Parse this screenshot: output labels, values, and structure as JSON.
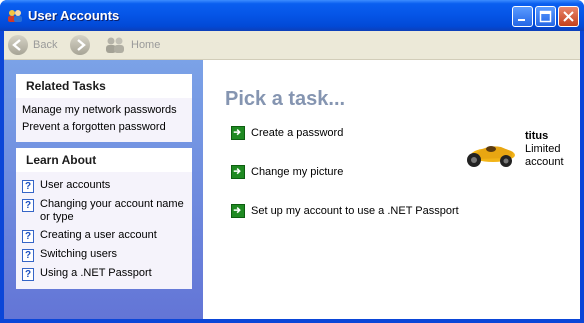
{
  "window": {
    "title": "User Accounts"
  },
  "toolbar": {
    "back_label": "Back",
    "home_label": "Home"
  },
  "related_tasks": {
    "heading": "Related Tasks",
    "links": [
      "Manage my network passwords",
      "Prevent a forgotten password"
    ]
  },
  "learn_about": {
    "heading": "Learn About",
    "items": [
      "User accounts",
      "Changing your account name or type",
      "Creating a user account",
      "Switching users",
      "Using a .NET Passport"
    ]
  },
  "main": {
    "heading": "Pick a task...",
    "tasks": [
      "Create a password",
      "Change my picture",
      "Set up my account to use a .NET Passport"
    ]
  },
  "account": {
    "name": "titus",
    "type": "Limited account"
  }
}
